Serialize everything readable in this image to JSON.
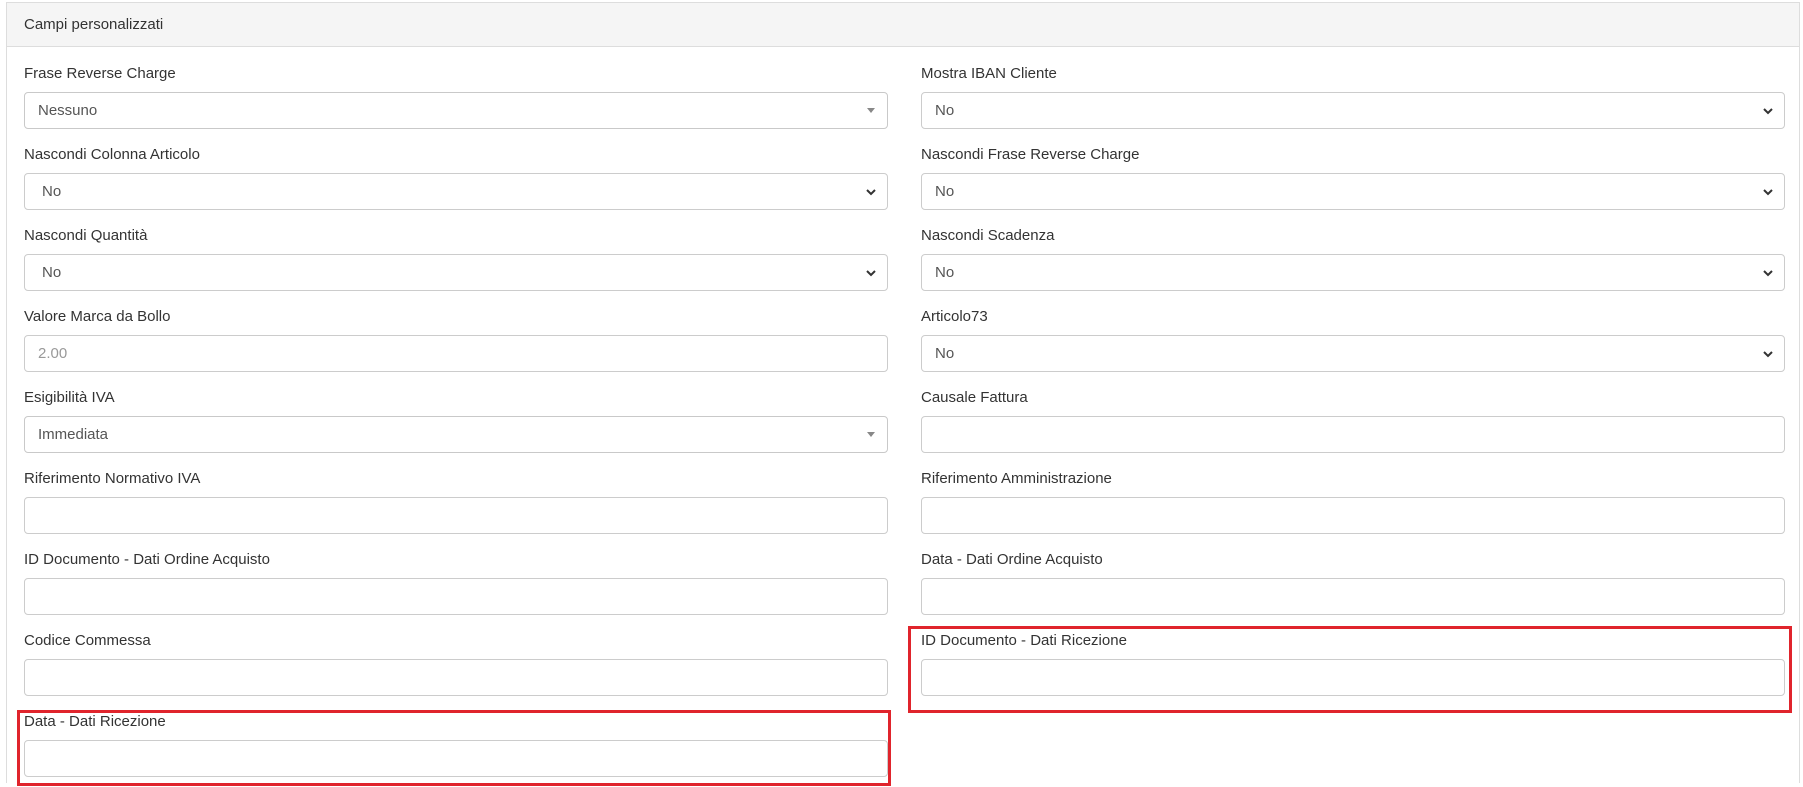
{
  "panel": {
    "title": "Campi personalizzati"
  },
  "fields": {
    "frase_reverse_charge": {
      "label": "Frase Reverse Charge",
      "value": "Nessuno"
    },
    "mostra_iban_cliente": {
      "label": "Mostra IBAN Cliente",
      "value": "No"
    },
    "nascondi_colonna_articolo": {
      "label": "Nascondi Colonna Articolo",
      "value": "No"
    },
    "nascondi_frase_reverse_charge": {
      "label": "Nascondi Frase Reverse Charge",
      "value": "No"
    },
    "nascondi_quantita": {
      "label": "Nascondi Quantità",
      "value": "No"
    },
    "nascondi_scadenza": {
      "label": "Nascondi Scadenza",
      "value": "No"
    },
    "valore_marca_da_bollo": {
      "label": "Valore Marca da Bollo",
      "placeholder": "2.00"
    },
    "articolo73": {
      "label": "Articolo73",
      "value": "No"
    },
    "esigibilita_iva": {
      "label": "Esigibilità IVA",
      "value": "Immediata"
    },
    "causale_fattura": {
      "label": "Causale Fattura",
      "value": ""
    },
    "riferimento_normativo_iva": {
      "label": "Riferimento Normativo IVA",
      "value": ""
    },
    "riferimento_amministrazione": {
      "label": "Riferimento Amministrazione",
      "value": ""
    },
    "id_documento_ordine_acquisto": {
      "label": "ID Documento - Dati Ordine Acquisto",
      "value": ""
    },
    "data_ordine_acquisto": {
      "label": "Data - Dati Ordine Acquisto",
      "value": ""
    },
    "codice_commessa": {
      "label": "Codice Commessa",
      "value": ""
    },
    "id_documento_dati_ricezione": {
      "label": "ID Documento - Dati Ricezione",
      "value": ""
    },
    "data_dati_ricezione": {
      "label": "Data - Dati Ricezione",
      "value": ""
    }
  },
  "highlight_color": "#e0242c"
}
